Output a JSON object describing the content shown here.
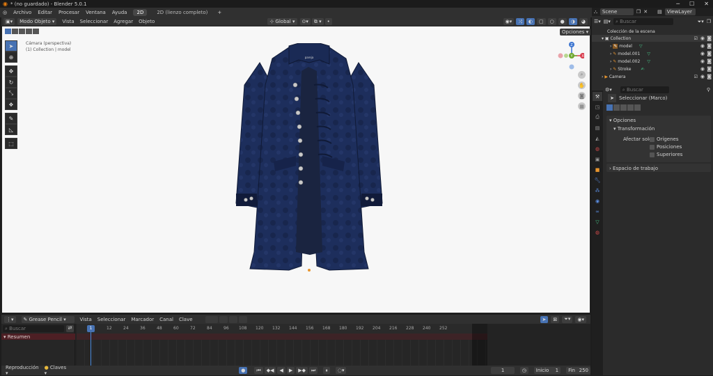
{
  "titlebar": {
    "title": "* (no guardado) - Blender 5.0.1",
    "minimize": "─",
    "maximize": "☐",
    "close": "✕"
  },
  "menu": {
    "items": [
      "Archivo",
      "Editar",
      "Procesar",
      "Ventana",
      "Ayuda"
    ],
    "workspaces": [
      "2D",
      "2D (lienzo completo)"
    ],
    "add_workspace": "+"
  },
  "viewport_header": {
    "mode": "Modo Objeto",
    "menus": [
      "Vista",
      "Seleccionar",
      "Agregar",
      "Objeto"
    ],
    "orientation": "Global",
    "options": "Opciones"
  },
  "viewport": {
    "camera_label": "Cámara (perspectiva)",
    "collection_label": "(1) Collection | model",
    "jacket_label": "pareja",
    "gizmo": {
      "z": "Z",
      "y": "Y",
      "x": "X"
    }
  },
  "timeline": {
    "editor": "Grease Pencil",
    "menus": [
      "Vista",
      "Seleccionar",
      "Marcador",
      "Canal",
      "Clave"
    ],
    "search_placeholder": "Buscar",
    "summary": "Resumen",
    "current_frame_marker": "1",
    "ticks": [
      "12",
      "24",
      "36",
      "48",
      "60",
      "72",
      "84",
      "96",
      "108",
      "120",
      "132",
      "144",
      "156",
      "168",
      "180",
      "192",
      "204",
      "216",
      "228",
      "240",
      "252"
    ],
    "playback": "Reproducción",
    "keying": "Claves",
    "current_frame": "1",
    "start_label": "Inicio",
    "start": "1",
    "end_label": "Fin",
    "end": "250"
  },
  "outliner": {
    "scene": "Scene",
    "view_layer": "ViewLayer",
    "search_placeholder": "Buscar",
    "rows": [
      {
        "label": "Colección de la escena",
        "indent": 0
      },
      {
        "label": "Collection",
        "indent": 1
      },
      {
        "label": "model",
        "indent": 2
      },
      {
        "label": "model.001",
        "indent": 2
      },
      {
        "label": "model.002",
        "indent": 2
      },
      {
        "label": "Stroke",
        "indent": 2
      },
      {
        "label": "Camera",
        "indent": 1
      }
    ]
  },
  "properties": {
    "search_placeholder": "Buscar",
    "tool_name": "Seleccionar (Marco)",
    "options_header": "Opciones",
    "transform_header": "Transformación",
    "affect_only": "Afectar solo",
    "checkboxes": [
      "Orígenes",
      "Posiciones",
      "Superiores"
    ],
    "workspace_header": "Espacio de trabajo"
  }
}
